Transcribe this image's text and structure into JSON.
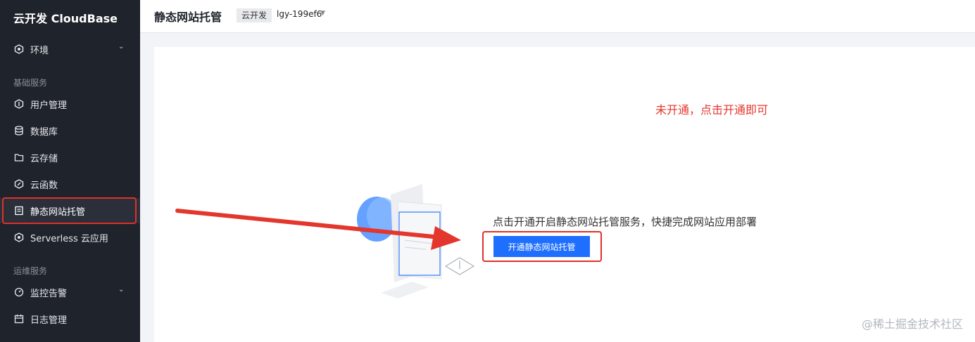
{
  "sidebar": {
    "brand": "云开发 CloudBase",
    "items": [
      {
        "label": "环境",
        "icon": "hexagon-icon"
      },
      {
        "label": "用户管理",
        "icon": "user-shield-icon"
      },
      {
        "label": "数据库",
        "icon": "database-icon"
      },
      {
        "label": "云存储",
        "icon": "folder-icon"
      },
      {
        "label": "云函数",
        "icon": "function-icon"
      },
      {
        "label": "静态网站托管",
        "icon": "document-icon"
      },
      {
        "label": "Serverless 云应用",
        "icon": "hexagon-icon"
      },
      {
        "label": "监控告警",
        "icon": "gauge-icon"
      },
      {
        "label": "日志管理",
        "icon": "calendar-icon"
      }
    ],
    "sections": [
      "基础服务",
      "运维服务"
    ]
  },
  "header": {
    "title": "静态网站托管",
    "env_badge": "云开发",
    "env_id": "lgy-199ef6"
  },
  "main": {
    "annotation": "未开通，点击开通即可",
    "description": "点击开通开启静态网站托管服务，快捷完成网站应用部署",
    "button_label": "开通静态网站托管"
  },
  "watermark": "@稀土掘金技术社区",
  "colors": {
    "sidebar_bg": "#1f232b",
    "primary": "#1f6fff",
    "annotation_red": "#e3362c"
  }
}
